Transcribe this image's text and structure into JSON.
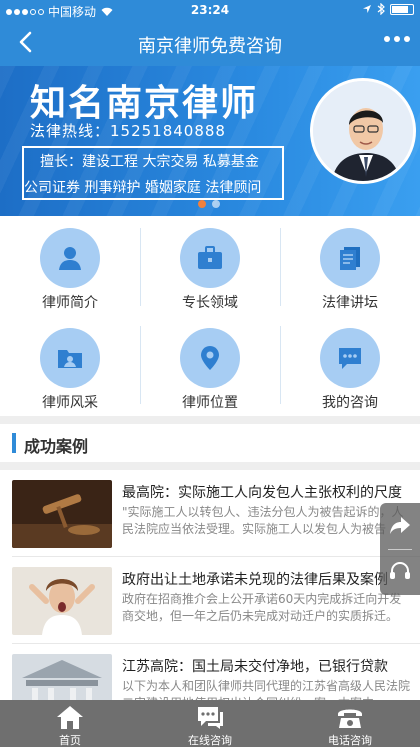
{
  "status": {
    "carrier": "中国移动",
    "time": "23:24"
  },
  "nav": {
    "title": "南京律师免费咨询",
    "back_icon": "chevron-left-icon",
    "more_icon": "more-dots-icon"
  },
  "banner": {
    "title": "知名南京律师",
    "hotline": "法律热线：15251840888",
    "line1": "擅长：建设工程  大宗交易  私募基金",
    "line2": "公司证券  刑事辩护  婚姻家庭  法律顾问",
    "pager": {
      "total": 2,
      "active": 1
    }
  },
  "grid": [
    {
      "label": "律师简介",
      "icon": "user-icon"
    },
    {
      "label": "专长领域",
      "icon": "briefcase-icon"
    },
    {
      "label": "法律讲坛",
      "icon": "document-icon"
    },
    {
      "label": "律师风采",
      "icon": "photo-folder-icon"
    },
    {
      "label": "律师位置",
      "icon": "location-pin-icon"
    },
    {
      "label": "我的咨询",
      "icon": "chat-bubble-icon"
    }
  ],
  "section": {
    "title": "成功案例"
  },
  "articles": [
    {
      "title": "最高院：实际施工人向发包人主张权利的尺度",
      "desc": "\"实际施工人以转包人、违法分包人为被告起诉的，人民法院应当依法受理。实际施工人以发包人为被告"
    },
    {
      "title": "政府出让土地承诺未兑现的法律后果及案例",
      "desc": "政府在招商推介会上公开承诺60天内完成拆迁向开发商交地，但一年之后仍未完成对动迁户的实质拆迁。"
    },
    {
      "title": "江苏高院：国土局未交付净地，已银行贷款",
      "desc": "以下为本人和团队律师共同代理的江苏省高级人民法院二审建设用地使用权出让合同纠纷一案。本案中"
    }
  ],
  "float": {
    "top_icon": "share-arrow-icon",
    "bottom_icon": "headset-icon"
  },
  "tabs": [
    {
      "label": "首页",
      "icon": "home-icon"
    },
    {
      "label": "在线咨询",
      "icon": "chat-icon"
    },
    {
      "label": "电话咨询",
      "icon": "phone-icon"
    }
  ],
  "colors": {
    "primary": "#2f8bd8",
    "icon_bg": "#a7cdf3",
    "tabbar": "#6f6f6f"
  }
}
